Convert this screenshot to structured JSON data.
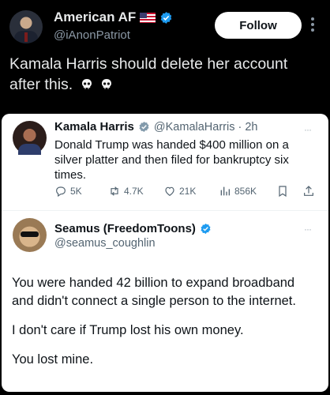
{
  "post": {
    "display_name": "American AF",
    "handle": "@iAnonPatriot",
    "follow_label": "Follow",
    "text_line1": "Kamala Harris should delete her account",
    "text_line2": "after this."
  },
  "quoted_tweet": {
    "display_name": "Kamala Harris",
    "handle_time": "@KamalaHarris · 2h",
    "text_lines": [
      "Donald Trump was handed $400 million on a",
      "silver platter and then filed for bankruptcy six",
      "times."
    ],
    "actions": {
      "replies": "5K",
      "retweets": "4.7K",
      "likes": "21K",
      "views": "856K"
    },
    "more_label": "···"
  },
  "reply_tweet": {
    "display_name": "Seamus (FreedomToons)",
    "handle": "@seamus_coughlin",
    "more_label": "···",
    "paragraph1_lines": [
      "You were handed 42 billion to expand broadband",
      "and didn't connect a single person to the internet."
    ],
    "paragraph2": "I don't care if Trump lost his own money.",
    "paragraph3": "You lost mine."
  },
  "colors": {
    "background": "#000000",
    "card": "#ffffff",
    "verified_blue": "#1d9bf0",
    "muted": "#536471"
  },
  "icons": [
    "flag-us-icon",
    "verified-badge-icon",
    "more-options-icon",
    "skull-icon",
    "reply-icon",
    "retweet-icon",
    "like-icon",
    "views-icon",
    "bookmark-icon",
    "share-icon"
  ]
}
